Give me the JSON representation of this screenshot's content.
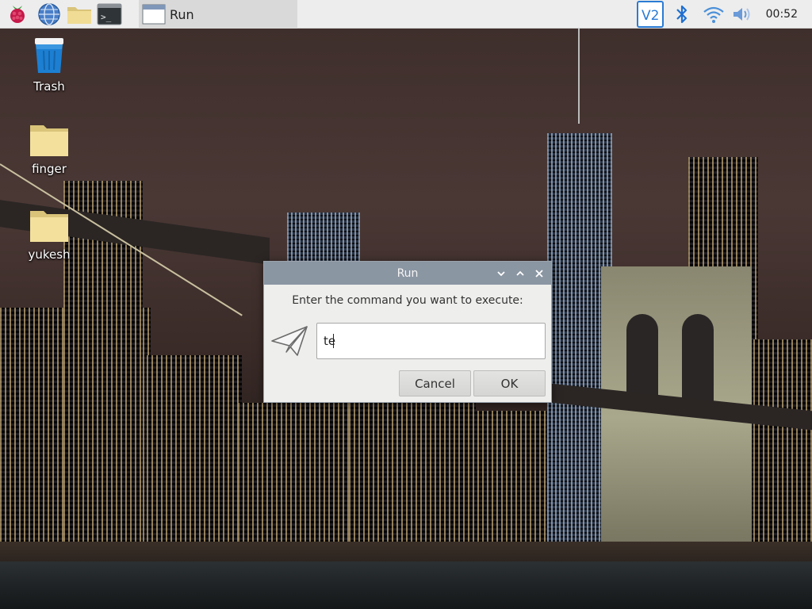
{
  "panel": {
    "launchers": [
      {
        "name": "raspberry-menu-icon"
      },
      {
        "name": "web-browser-icon"
      },
      {
        "name": "file-manager-icon"
      },
      {
        "name": "terminal-icon"
      }
    ],
    "task": {
      "label": "Run",
      "icon": "window-icon"
    },
    "tray": {
      "vnc_label": "V2",
      "clock": "00:52"
    }
  },
  "desktop": {
    "icons": [
      {
        "label": "Trash",
        "icon": "trash-icon"
      },
      {
        "label": "finger",
        "icon": "folder-icon"
      },
      {
        "label": "yukesh",
        "icon": "folder-icon"
      }
    ]
  },
  "dialog": {
    "title": "Run",
    "prompt": "Enter the command you want to execute:",
    "command_value": "te",
    "cancel_label": "Cancel",
    "ok_label": "OK"
  },
  "colors": {
    "panel_bg": "#ededed",
    "dialog_titlebar": "#8b96a3",
    "dialog_bg": "#eeeeec",
    "vnc_accent": "#2a7bd4",
    "bluetooth": "#1f6fd0"
  }
}
